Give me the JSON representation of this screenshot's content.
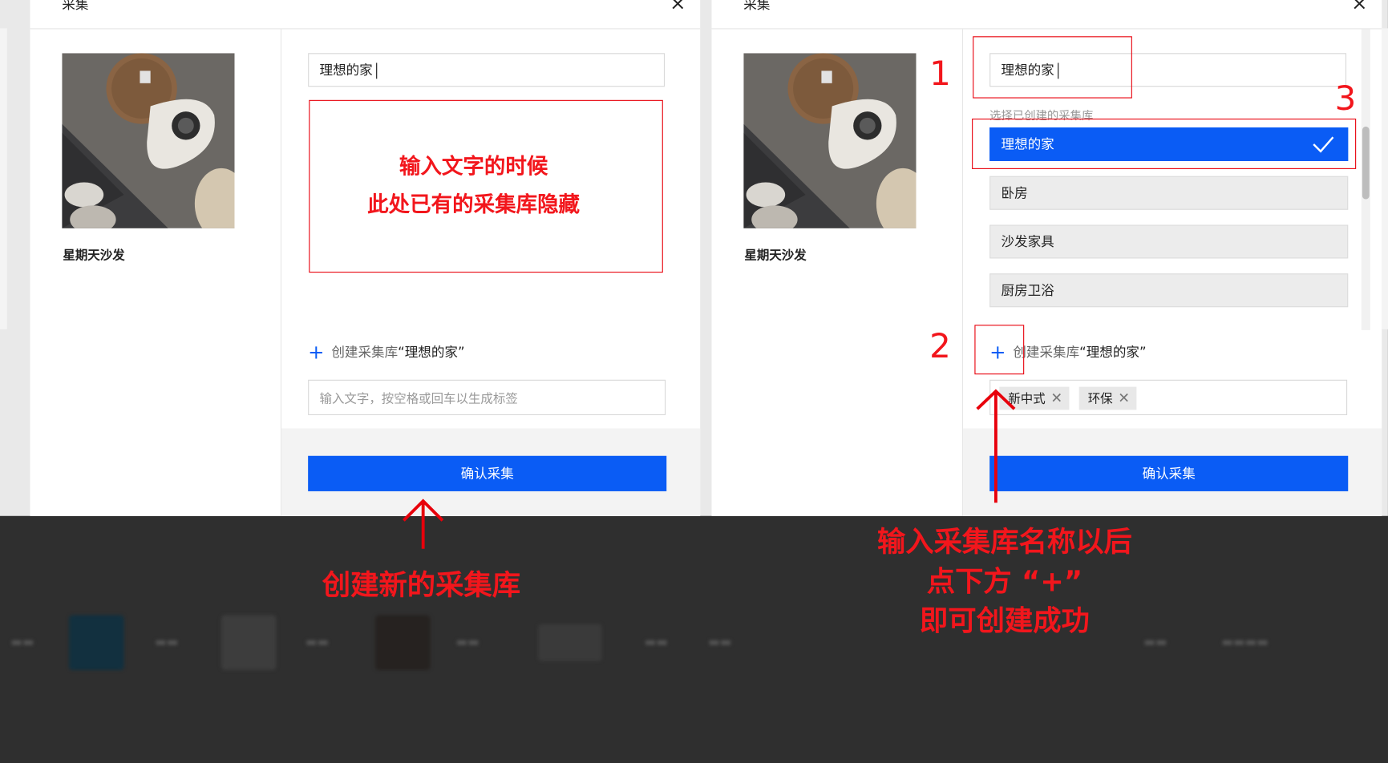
{
  "left_panel": {
    "modal_title": "采集",
    "close_icon": "×",
    "image_caption": "星期天沙发",
    "name_input_value": "理想的家",
    "create_prefix": "创建采集库",
    "create_quoted": "“理想的家”",
    "tag_placeholder": "输入文字，按空格或回车以生成标签",
    "confirm_label": "确认采集",
    "note_line1": "输入文字的时候",
    "note_line2": "此处已有的采集库隐藏",
    "arrow_caption": "创建新的采集库"
  },
  "right_panel": {
    "modal_title": "采集",
    "close_icon": "×",
    "image_caption": "星期天沙发",
    "name_input_value": "理想的家",
    "library_hint": "选择已创建的采集库",
    "libraries": [
      {
        "label": "理想的家",
        "selected": true
      },
      {
        "label": "卧房",
        "selected": false
      },
      {
        "label": "沙发家具",
        "selected": false
      },
      {
        "label": "厨房卫浴",
        "selected": false
      }
    ],
    "create_prefix": "创建采集库",
    "create_quoted": "“理想的家”",
    "tags": [
      "新中式",
      "环保"
    ],
    "confirm_label": "确认采集",
    "marker_1": "1",
    "marker_2": "2",
    "marker_3": "3",
    "caption_line1": "输入采集库名称以后",
    "caption_line2": "点下方 “+”",
    "caption_line3": "即可创建成功"
  },
  "colors": {
    "accent": "#0a5cf5",
    "annotation_red": "#f2161c",
    "backdrop": "#2f2f2f"
  }
}
